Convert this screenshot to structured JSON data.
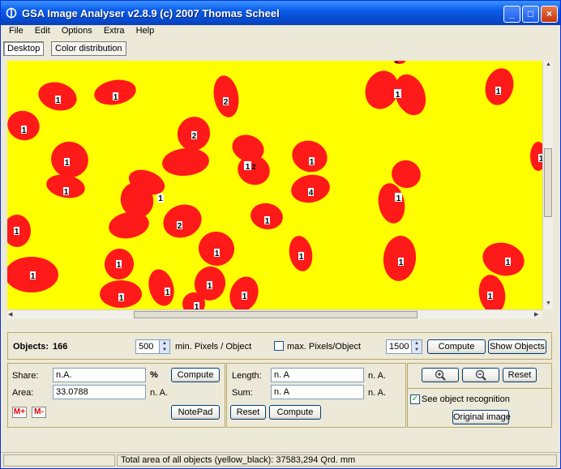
{
  "window": {
    "title": "GSA Image Analyser v2.8.9 (c) 2007 Thomas Scheel",
    "minimize": "_",
    "maximize": "□",
    "close": "×"
  },
  "menu": [
    "File",
    "Edit",
    "Options",
    "Extra",
    "Help"
  ],
  "tabs": [
    "Desktop",
    "Color distribution"
  ],
  "image": {
    "background_color": "#ffff00",
    "object_color": "#ff1a1a",
    "labels": [
      "1",
      "1",
      "2",
      "1",
      "1",
      "1",
      "2",
      "1",
      "1",
      "1",
      "1",
      "4",
      "1",
      "2",
      "1",
      "1",
      "1",
      "1",
      "1",
      "1",
      "1",
      "1",
      "1",
      "1",
      "1",
      "1",
      "1",
      "1",
      "1",
      "1",
      "2",
      "1"
    ]
  },
  "objects_bar": {
    "objects_label": "Objects:",
    "objects_count": "166",
    "min_pixels_value": "500",
    "min_pixels_label": "min. Pixels / Object",
    "max_pixels_label": "max. Pixels/Object",
    "max_pixels_value": "1500",
    "compute_label": "Compute",
    "show_objects_label": "Show Objects"
  },
  "share_panel": {
    "share_label": "Share:",
    "share_value": "n.A.",
    "share_unit": "%",
    "compute_label": "Compute",
    "area_label": "Area:",
    "area_value": "33.0788",
    "area_unit": "n. A.",
    "mplus_label": "M+",
    "mminus_label": "M-",
    "notepad_label": "NotePad"
  },
  "length_panel": {
    "length_label": "Length:",
    "length_value": "n. A",
    "length_unit": "n. A.",
    "sum_label": "Sum:",
    "sum_value": "n. A",
    "sum_unit": "n. A.",
    "reset_label": "Reset",
    "compute_label": "Compute"
  },
  "view_panel": {
    "zoom_in_icon": "+",
    "zoom_out_icon": "−",
    "reset_label": "Reset",
    "see_object_recognition_label": "See object recognition",
    "see_object_recognition_checked": "✓",
    "original_image_label": "Original image"
  },
  "status": {
    "text": "Total area of all objects (yellow_black): 37583,294 Qrd. mm"
  }
}
